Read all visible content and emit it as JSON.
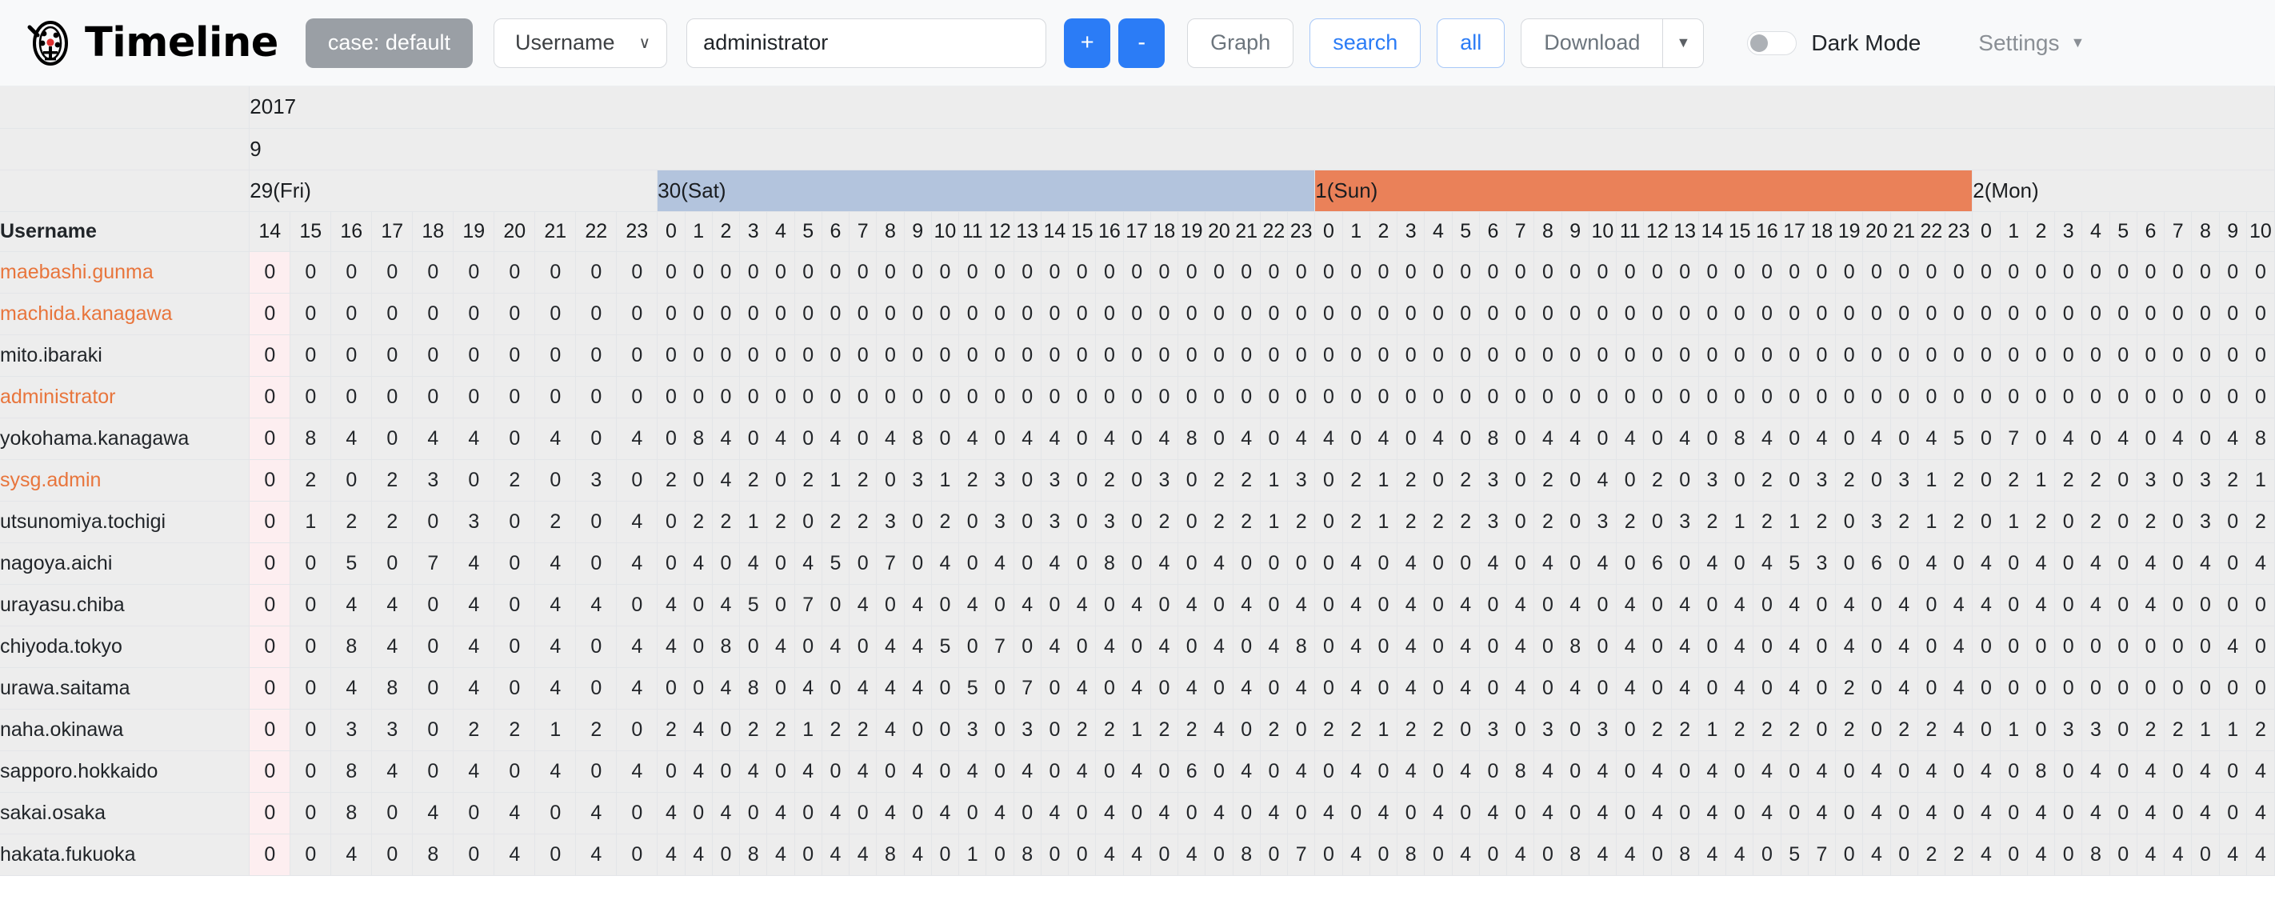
{
  "app": {
    "title": "Timeline",
    "logo_icon": "timeline-logo-icon"
  },
  "toolbar": {
    "case_label": "case: default",
    "field_select_label": "Username",
    "field_select_caret": "∨",
    "query_value": "administrator",
    "query_placeholder": "administrator",
    "plus_label": "+",
    "minus_label": "-",
    "graph_label": "Graph",
    "search_label": "search",
    "all_label": "all",
    "download_label": "Download",
    "download_caret": "▼",
    "dark_mode_label": "Dark Mode",
    "dark_mode_on": false,
    "settings_label": "Settings",
    "settings_caret": "▼",
    "accent_blue": "#2b7cf6",
    "case_grey": "#9a9fa5"
  },
  "colors": {
    "saturday_band": "#b3c4dd",
    "sunday_band": "#ea8159",
    "highlight_username": "#e8753c",
    "first_column_tint": "#fdeef0",
    "grid_bg": "#ededed"
  },
  "grid": {
    "year": "2017",
    "month": "9",
    "username_header": "Username",
    "days": [
      {
        "label": "29(Fri)",
        "kind": "weekday",
        "hours": [
          14,
          15,
          16,
          17,
          18,
          19,
          20,
          21,
          22,
          23
        ]
      },
      {
        "label": "30(Sat)",
        "kind": "saturday",
        "hours": [
          0,
          1,
          2,
          3,
          4,
          5,
          6,
          7,
          8,
          9,
          10,
          11,
          12,
          13,
          14,
          15,
          16,
          17,
          18,
          19,
          20,
          21,
          22,
          23
        ]
      },
      {
        "label": "1(Sun)",
        "kind": "sunday",
        "hours": [
          0,
          1,
          2,
          3,
          4,
          5,
          6,
          7,
          8,
          9,
          10,
          11,
          12,
          13,
          14,
          15,
          16,
          17,
          18,
          19,
          20,
          21,
          22,
          23
        ]
      },
      {
        "label": "2(Mon)",
        "kind": "weekday",
        "hours": [
          0,
          1,
          2,
          3,
          4,
          5,
          6,
          7,
          8,
          9,
          10
        ]
      }
    ],
    "rows": [
      {
        "username": "maebashi.gunma",
        "highlight": true,
        "values": [
          0,
          0,
          0,
          0,
          0,
          0,
          0,
          0,
          0,
          0,
          0,
          0,
          0,
          0,
          0,
          0,
          0,
          0,
          0,
          0,
          0,
          0,
          0,
          0,
          0,
          0,
          0,
          0,
          0,
          0,
          0,
          0,
          0,
          0,
          0,
          0,
          0,
          0,
          0,
          0,
          0,
          0,
          0,
          0,
          0,
          0,
          0,
          0,
          0,
          0,
          0,
          0,
          0,
          0,
          0,
          0,
          0,
          0,
          0,
          0,
          0,
          0,
          0,
          0,
          0,
          0,
          0,
          0,
          0
        ]
      },
      {
        "username": "machida.kanagawa",
        "highlight": true,
        "values": [
          0,
          0,
          0,
          0,
          0,
          0,
          0,
          0,
          0,
          0,
          0,
          0,
          0,
          0,
          0,
          0,
          0,
          0,
          0,
          0,
          0,
          0,
          0,
          0,
          0,
          0,
          0,
          0,
          0,
          0,
          0,
          0,
          0,
          0,
          0,
          0,
          0,
          0,
          0,
          0,
          0,
          0,
          0,
          0,
          0,
          0,
          0,
          0,
          0,
          0,
          0,
          0,
          0,
          0,
          0,
          0,
          0,
          0,
          0,
          0,
          0,
          0,
          0,
          0,
          0,
          0,
          0,
          0,
          0
        ]
      },
      {
        "username": "mito.ibaraki",
        "highlight": false,
        "values": [
          0,
          0,
          0,
          0,
          0,
          0,
          0,
          0,
          0,
          0,
          0,
          0,
          0,
          0,
          0,
          0,
          0,
          0,
          0,
          0,
          0,
          0,
          0,
          0,
          0,
          0,
          0,
          0,
          0,
          0,
          0,
          0,
          0,
          0,
          0,
          0,
          0,
          0,
          0,
          0,
          0,
          0,
          0,
          0,
          0,
          0,
          0,
          0,
          0,
          0,
          0,
          0,
          0,
          0,
          0,
          0,
          0,
          0,
          0,
          0,
          0,
          0,
          0,
          0,
          0,
          0,
          0,
          0,
          0
        ]
      },
      {
        "username": "administrator",
        "highlight": true,
        "values": [
          0,
          0,
          0,
          0,
          0,
          0,
          0,
          0,
          0,
          0,
          0,
          0,
          0,
          0,
          0,
          0,
          0,
          0,
          0,
          0,
          0,
          0,
          0,
          0,
          0,
          0,
          0,
          0,
          0,
          0,
          0,
          0,
          0,
          0,
          0,
          0,
          0,
          0,
          0,
          0,
          0,
          0,
          0,
          0,
          0,
          0,
          0,
          0,
          0,
          0,
          0,
          0,
          0,
          0,
          0,
          0,
          0,
          0,
          0,
          0,
          0,
          0,
          0,
          0,
          0,
          0,
          0,
          0,
          0
        ]
      },
      {
        "username": "yokohama.kanagawa",
        "highlight": false,
        "values": [
          0,
          8,
          4,
          0,
          4,
          4,
          0,
          4,
          0,
          4,
          0,
          8,
          4,
          0,
          4,
          0,
          4,
          0,
          4,
          8,
          0,
          4,
          0,
          4,
          4,
          0,
          4,
          0,
          4,
          8,
          0,
          4,
          0,
          4,
          4,
          0,
          4,
          0,
          4,
          0,
          8,
          0,
          4,
          4,
          0,
          4,
          0,
          4,
          0,
          8,
          4,
          0,
          4,
          0,
          4,
          0,
          4,
          5,
          0,
          7,
          0,
          4,
          0,
          4,
          0,
          4,
          0,
          4,
          8
        ]
      },
      {
        "username": "sysg.admin",
        "highlight": true,
        "values": [
          0,
          2,
          0,
          2,
          3,
          0,
          2,
          0,
          3,
          0,
          2,
          0,
          4,
          2,
          0,
          2,
          1,
          2,
          0,
          3,
          1,
          2,
          3,
          0,
          3,
          0,
          2,
          0,
          3,
          0,
          2,
          2,
          1,
          3,
          0,
          2,
          1,
          2,
          0,
          2,
          3,
          0,
          2,
          0,
          4,
          0,
          2,
          0,
          3,
          0,
          2,
          0,
          3,
          2,
          0,
          3,
          1,
          2,
          0,
          2,
          1,
          2,
          2,
          0,
          3,
          0,
          3,
          2,
          1
        ]
      },
      {
        "username": "utsunomiya.tochigi",
        "highlight": false,
        "values": [
          0,
          1,
          2,
          2,
          0,
          3,
          0,
          2,
          0,
          4,
          0,
          2,
          2,
          1,
          2,
          0,
          2,
          2,
          3,
          0,
          2,
          0,
          3,
          0,
          3,
          0,
          3,
          0,
          2,
          0,
          2,
          2,
          1,
          2,
          0,
          2,
          1,
          2,
          2,
          2,
          3,
          0,
          2,
          0,
          3,
          2,
          0,
          3,
          2,
          1,
          2,
          1,
          2,
          0,
          3,
          2,
          1,
          2,
          0,
          1,
          2,
          0,
          2,
          0,
          2,
          0,
          3,
          0,
          2
        ]
      },
      {
        "username": "nagoya.aichi",
        "highlight": false,
        "values": [
          0,
          0,
          5,
          0,
          7,
          4,
          0,
          4,
          0,
          4,
          0,
          4,
          0,
          4,
          0,
          4,
          5,
          0,
          7,
          0,
          4,
          0,
          4,
          0,
          4,
          0,
          8,
          0,
          4,
          0,
          4,
          0,
          0,
          0,
          0,
          4,
          0,
          4,
          0,
          0,
          4,
          0,
          4,
          0,
          4,
          0,
          6,
          0,
          4,
          0,
          4,
          5,
          3,
          0,
          6,
          0,
          4,
          0,
          4,
          0,
          4,
          0,
          4,
          0,
          4,
          0,
          4,
          0,
          4
        ]
      },
      {
        "username": "urayasu.chiba",
        "highlight": false,
        "values": [
          0,
          0,
          4,
          4,
          0,
          4,
          0,
          4,
          4,
          0,
          4,
          0,
          4,
          5,
          0,
          7,
          0,
          4,
          0,
          4,
          0,
          4,
          0,
          4,
          0,
          4,
          0,
          4,
          0,
          4,
          0,
          4,
          0,
          4,
          0,
          4,
          0,
          4,
          0,
          4,
          0,
          4,
          0,
          4,
          0,
          4,
          0,
          4,
          0,
          4,
          0,
          4,
          0,
          4,
          0,
          4,
          0,
          4,
          4,
          0,
          4,
          0,
          4,
          0,
          4,
          0,
          0,
          0,
          0
        ]
      },
      {
        "username": "chiyoda.tokyo",
        "highlight": false,
        "values": [
          0,
          0,
          8,
          4,
          0,
          4,
          0,
          4,
          0,
          4,
          4,
          0,
          8,
          0,
          4,
          0,
          4,
          0,
          4,
          4,
          5,
          0,
          7,
          0,
          4,
          0,
          4,
          0,
          4,
          0,
          4,
          0,
          4,
          8,
          0,
          4,
          0,
          4,
          0,
          4,
          0,
          4,
          0,
          8,
          0,
          4,
          0,
          4,
          0,
          4,
          0,
          4,
          0,
          4,
          0,
          4,
          0,
          4,
          0,
          0,
          0,
          0,
          0,
          0,
          0,
          0,
          0,
          4,
          0
        ]
      },
      {
        "username": "urawa.saitama",
        "highlight": false,
        "values": [
          0,
          0,
          4,
          8,
          0,
          4,
          0,
          4,
          0,
          4,
          0,
          0,
          4,
          8,
          0,
          4,
          0,
          4,
          4,
          4,
          0,
          5,
          0,
          7,
          0,
          4,
          0,
          4,
          0,
          4,
          0,
          4,
          0,
          4,
          0,
          4,
          0,
          4,
          0,
          4,
          0,
          4,
          0,
          4,
          0,
          4,
          0,
          4,
          0,
          4,
          0,
          4,
          0,
          2,
          0,
          4,
          0,
          4,
          0,
          0,
          0,
          0,
          0,
          0,
          0,
          0,
          0,
          0,
          0
        ]
      },
      {
        "username": "naha.okinawa",
        "highlight": false,
        "values": [
          0,
          0,
          3,
          3,
          0,
          2,
          2,
          1,
          2,
          0,
          2,
          4,
          0,
          2,
          2,
          1,
          2,
          2,
          4,
          0,
          0,
          3,
          0,
          3,
          0,
          2,
          2,
          1,
          2,
          2,
          4,
          0,
          2,
          0,
          2,
          2,
          1,
          2,
          2,
          0,
          3,
          0,
          3,
          0,
          3,
          0,
          2,
          2,
          1,
          2,
          2,
          2,
          0,
          2,
          0,
          2,
          2,
          4,
          0,
          1,
          0,
          3,
          3,
          0,
          2,
          2,
          1,
          1,
          2
        ]
      },
      {
        "username": "sapporo.hokkaido",
        "highlight": false,
        "values": [
          0,
          0,
          8,
          4,
          0,
          4,
          0,
          4,
          0,
          4,
          0,
          4,
          0,
          4,
          0,
          4,
          0,
          4,
          0,
          4,
          0,
          4,
          0,
          4,
          0,
          4,
          0,
          4,
          0,
          6,
          0,
          4,
          0,
          4,
          0,
          4,
          0,
          4,
          0,
          4,
          0,
          8,
          4,
          0,
          4,
          0,
          4,
          0,
          4,
          0,
          4,
          0,
          4,
          0,
          4,
          0,
          4,
          0,
          4,
          0,
          8,
          0,
          4,
          0,
          4,
          0,
          4,
          0,
          4
        ]
      },
      {
        "username": "sakai.osaka",
        "highlight": false,
        "values": [
          0,
          0,
          8,
          0,
          4,
          0,
          4,
          0,
          4,
          0,
          4,
          0,
          4,
          0,
          4,
          0,
          4,
          0,
          4,
          0,
          4,
          0,
          4,
          0,
          4,
          0,
          4,
          0,
          4,
          0,
          4,
          0,
          4,
          0,
          4,
          0,
          4,
          0,
          4,
          0,
          4,
          0,
          4,
          0,
          4,
          0,
          4,
          0,
          4,
          0,
          4,
          0,
          4,
          0,
          4,
          0,
          4,
          0,
          4,
          0,
          4,
          0,
          4,
          0,
          4,
          0,
          4,
          0,
          4
        ]
      },
      {
        "username": "hakata.fukuoka",
        "highlight": false,
        "values": [
          0,
          0,
          4,
          0,
          8,
          0,
          4,
          0,
          4,
          0,
          4,
          4,
          0,
          8,
          4,
          0,
          4,
          4,
          8,
          4,
          0,
          1,
          0,
          8,
          0,
          0,
          4,
          4,
          0,
          4,
          0,
          8,
          0,
          7,
          0,
          4,
          0,
          8,
          0,
          4,
          0,
          4,
          0,
          8,
          4,
          4,
          0,
          8,
          4,
          4,
          0,
          5,
          7,
          0,
          4,
          0,
          2,
          2,
          4,
          0,
          4,
          0,
          8,
          0,
          4,
          4,
          0,
          4,
          4
        ]
      }
    ]
  }
}
